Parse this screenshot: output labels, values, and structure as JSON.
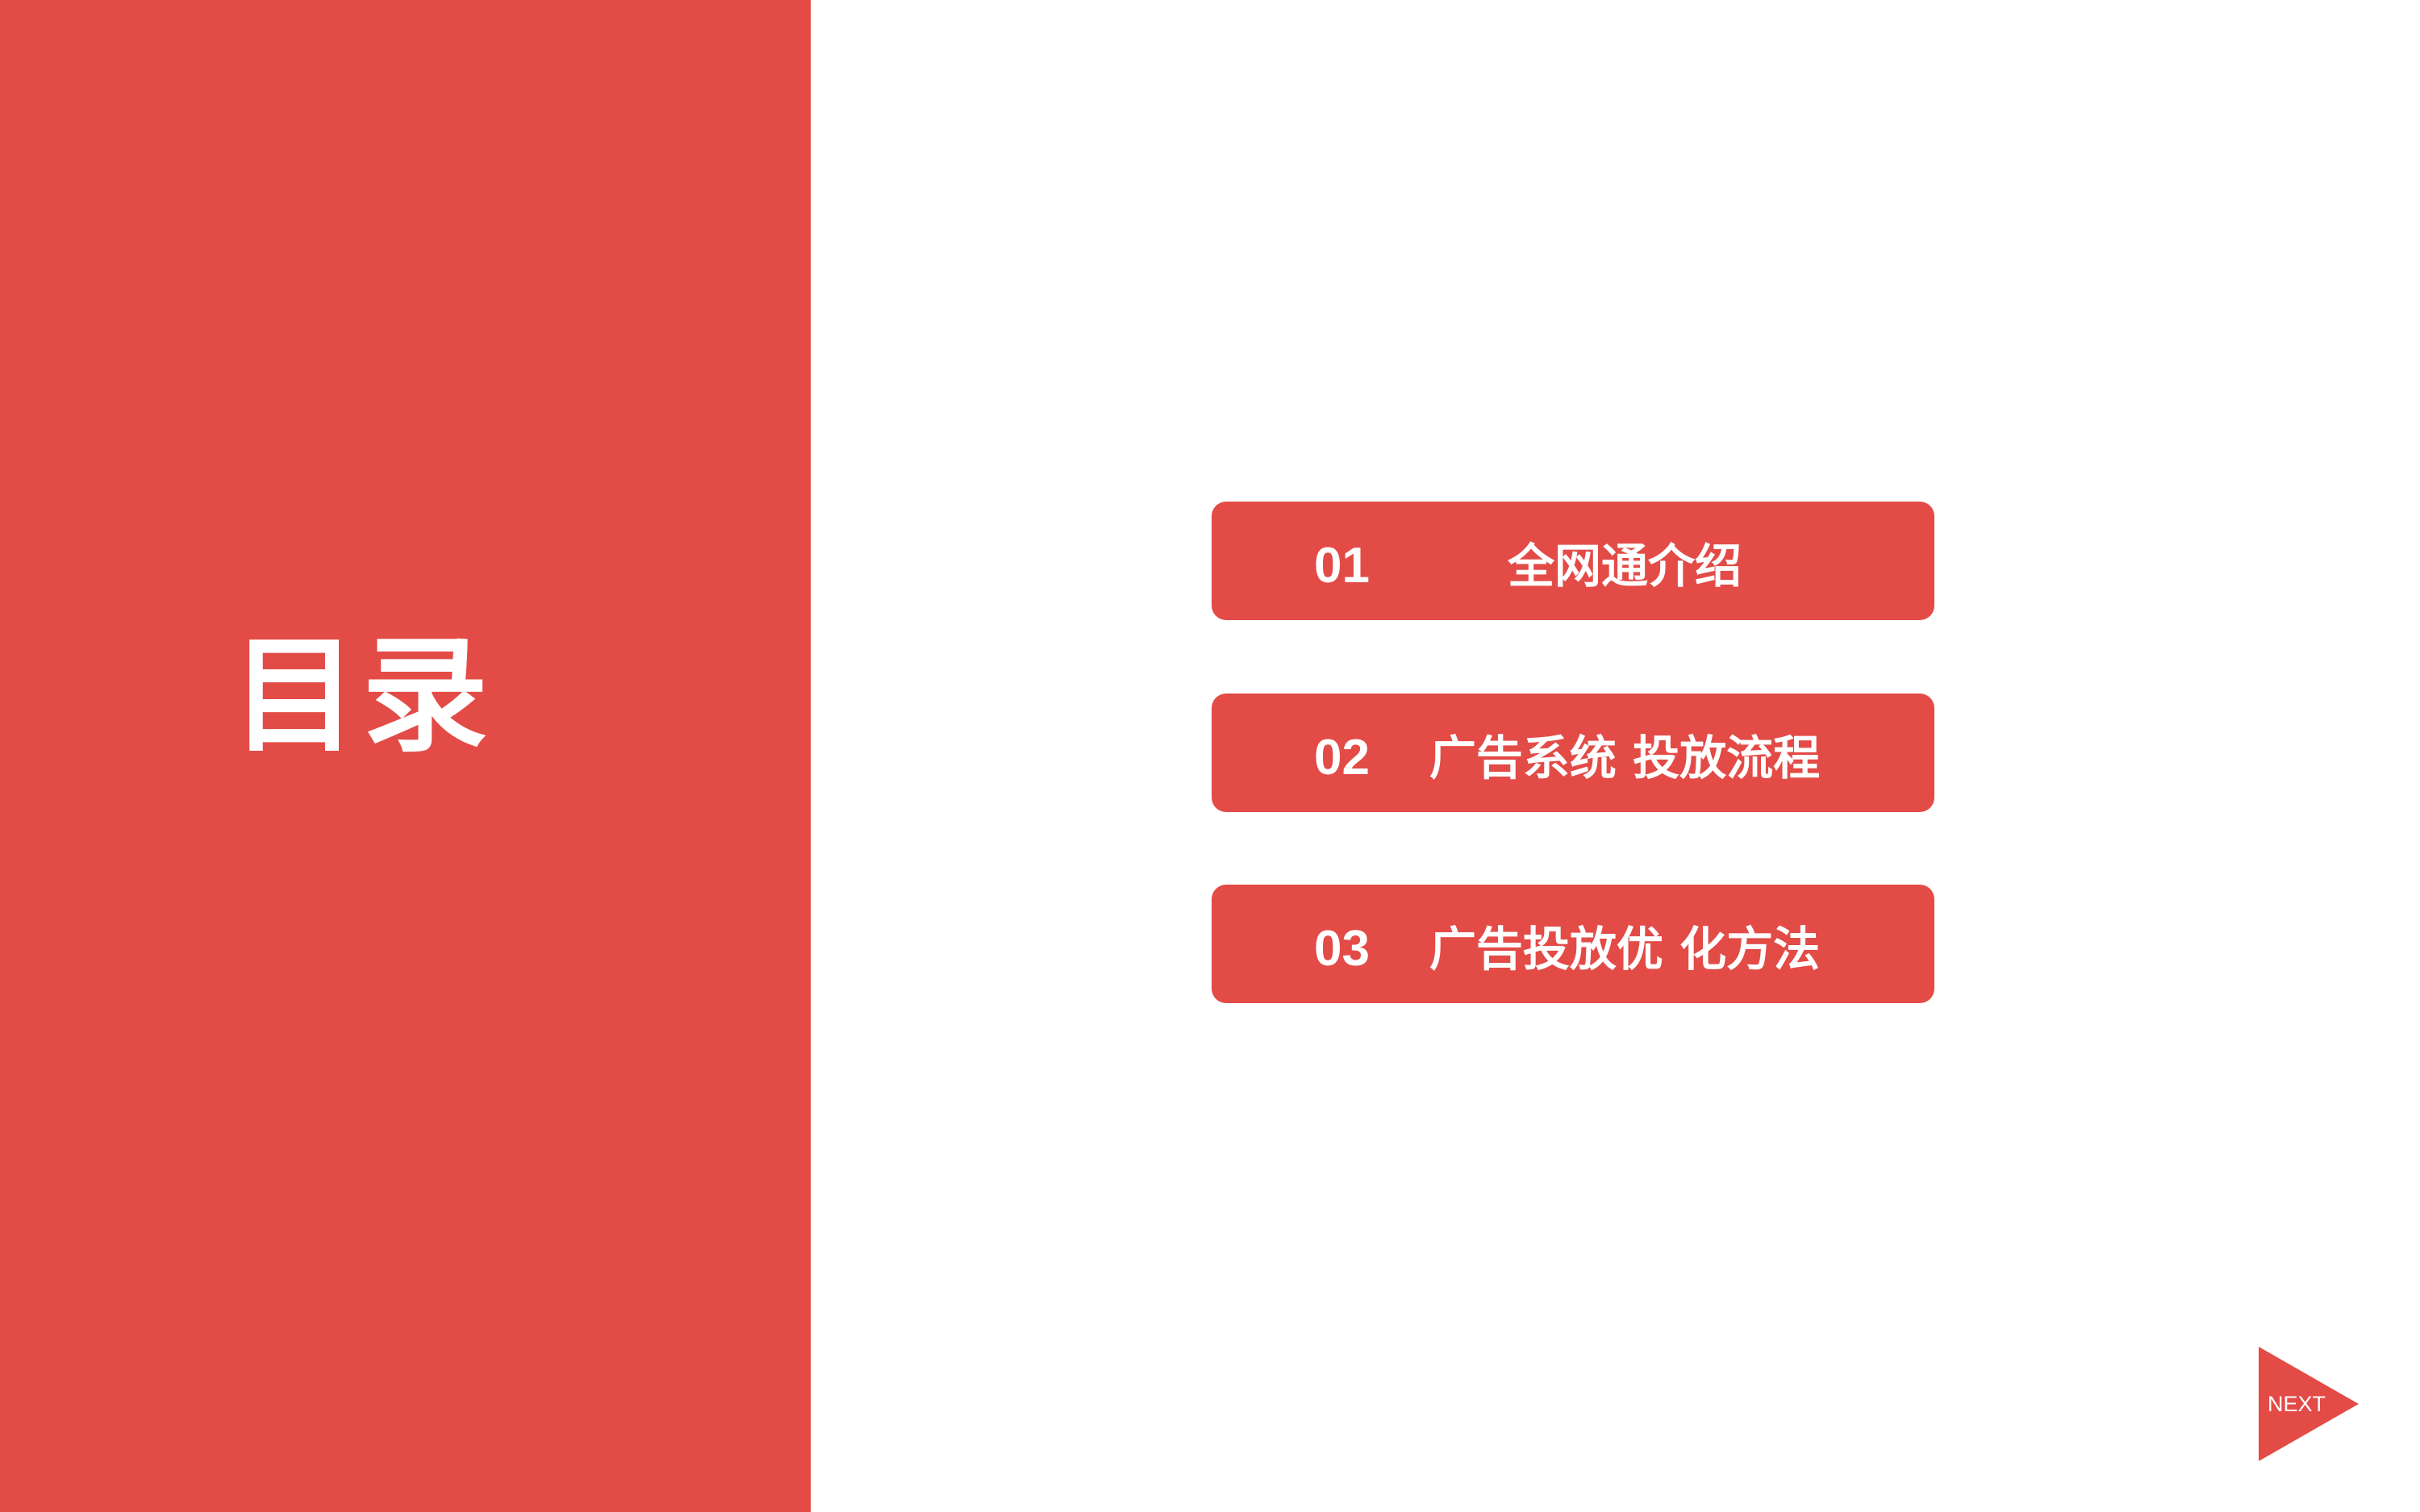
{
  "title": "目录",
  "menu": {
    "items": [
      {
        "number": "01",
        "label": "全网通介绍"
      },
      {
        "number": "02",
        "label": "广告系统 投放流程"
      },
      {
        "number": "03",
        "label": "广告投放优 化方法"
      }
    ]
  },
  "navigation": {
    "next_label": "NEXT"
  },
  "colors": {
    "accent": "#e34b47",
    "background": "#ffffff",
    "text_on_accent": "#ffffff"
  },
  "icons": {
    "next": "play-triangle-icon"
  }
}
